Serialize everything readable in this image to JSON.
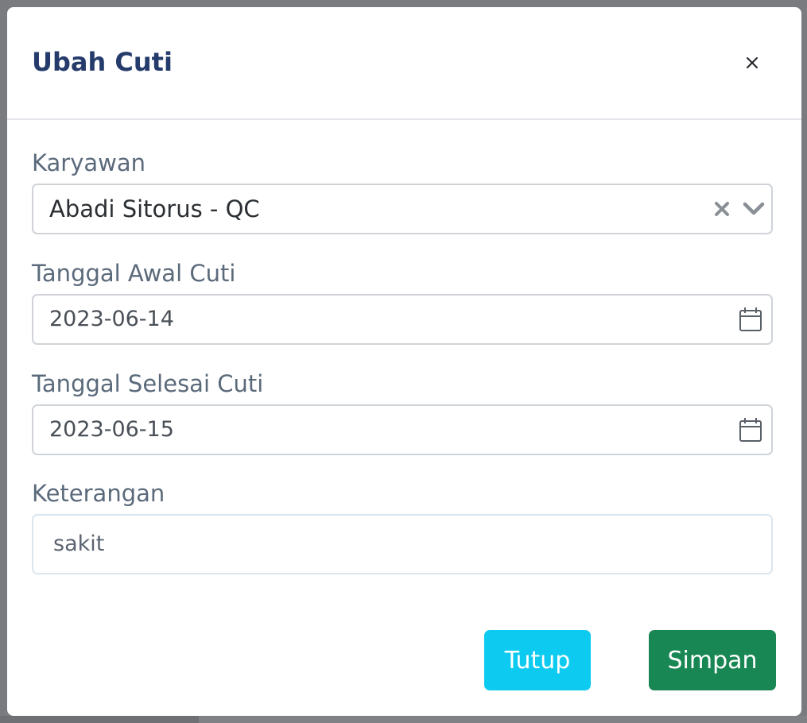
{
  "modal": {
    "title": "Ubah Cuti",
    "close_icon": "close-icon"
  },
  "form": {
    "employee": {
      "label": "Karyawan",
      "value": "Abadi Sitorus - QC",
      "icons": [
        "clear-x-icon",
        "chevron-down-icon"
      ]
    },
    "start_date": {
      "label": "Tanggal Awal Cuti",
      "value": "2023-06-14",
      "icon": "calendar-icon"
    },
    "end_date": {
      "label": "Tanggal Selesai Cuti",
      "value": "2023-06-15",
      "icon": "calendar-icon"
    },
    "description": {
      "label": "Keterangan",
      "value": "sakit"
    }
  },
  "footer": {
    "close_label": "Tutup",
    "save_label": "Simpan"
  },
  "colors": {
    "title": "#243b6b",
    "close_button": "#0dcaf0",
    "save_button": "#198754",
    "backdrop": "#7a7b7e"
  }
}
